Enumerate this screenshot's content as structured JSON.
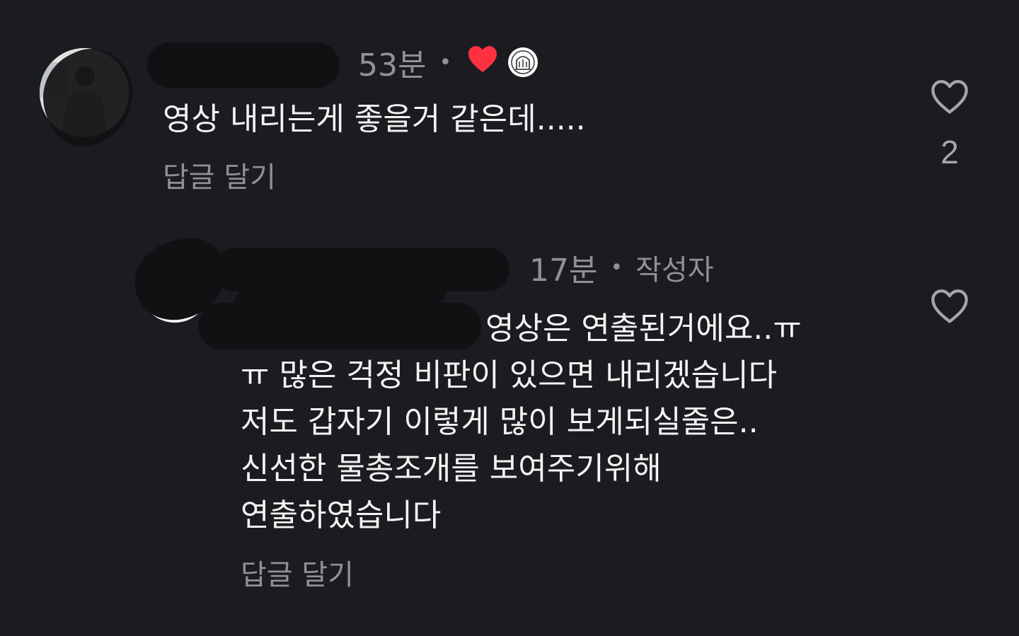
{
  "comments": [
    {
      "time": "53분",
      "dot": "•",
      "lines": [
        "영상 내리는게 좋을거 같은데....."
      ],
      "reply_label": "답글 달기",
      "like_count": "2",
      "creator_liked": true,
      "icons": {
        "liked": "heart-filled-icon",
        "like": "heart-outline-icon",
        "creator": "creator-avatar-icon"
      },
      "colors": {
        "heart": "#ff3040"
      }
    },
    {
      "time": "17분",
      "dot": "•",
      "author_tag": "작성자",
      "lines": [
        "영상은 연출된거에요..ㅠ",
        "ㅠ 많은 걱정 비판이 있으면 내리겠습니다",
        "저도 갑자기 이렇게 많이 보게되실줄은..",
        "신선한 물총조개를 보여주기위해",
        "연출하였습니다"
      ],
      "reply_label": "답글 달기",
      "icons": {
        "like": "heart-outline-icon"
      }
    }
  ]
}
